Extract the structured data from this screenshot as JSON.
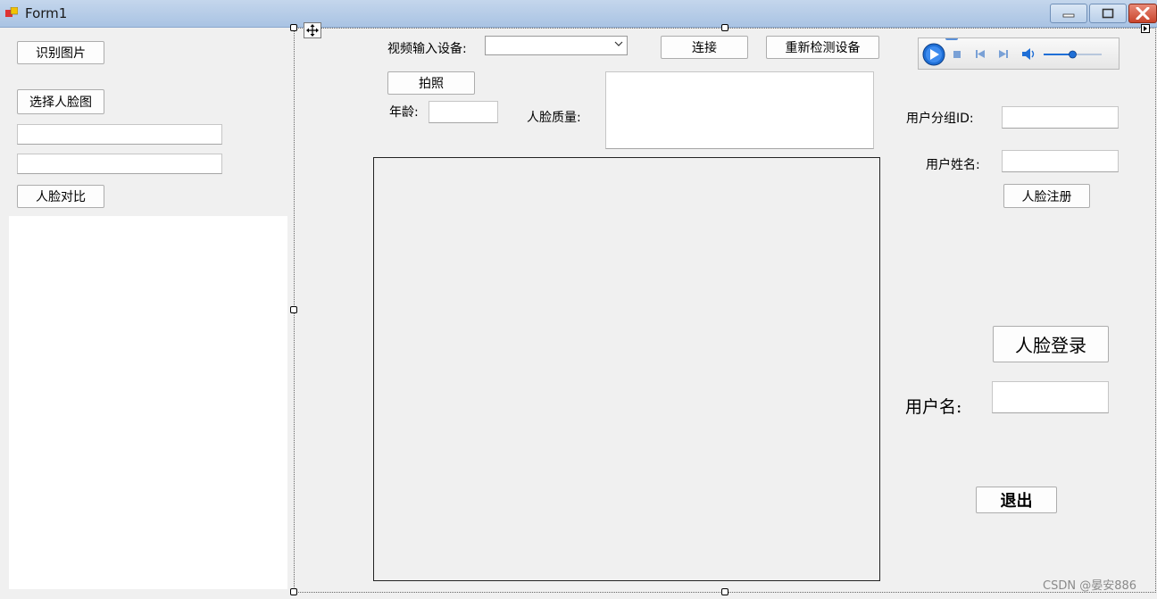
{
  "window": {
    "title": "Form1"
  },
  "left_panel": {
    "recognize_button": "识别图片",
    "select_face_button": "选择人脸图",
    "field1_value": "",
    "field2_value": "",
    "compare_button": "人脸对比"
  },
  "center": {
    "video_device_label": "视频输入设备:",
    "video_device_value": "",
    "connect_button": "连接",
    "redetect_button": "重新检测设备",
    "photo_button": "拍照",
    "age_label": "年龄:",
    "age_value": "",
    "quality_label": "人脸质量:",
    "quality_value": ""
  },
  "right_panel": {
    "group_id_label": "用户分组ID:",
    "group_id_value": "",
    "user_name_label": "用户姓名:",
    "user_name_value": "",
    "register_button": "人脸注册",
    "login_button": "人脸登录",
    "username_label": "用户名:",
    "username_value": "",
    "exit_button": "退出"
  },
  "player": {
    "volume": 0.5
  },
  "watermark": "CSDN @晏安886",
  "colors": {
    "accent": "#1f6fd6",
    "close": "#c9442c"
  }
}
